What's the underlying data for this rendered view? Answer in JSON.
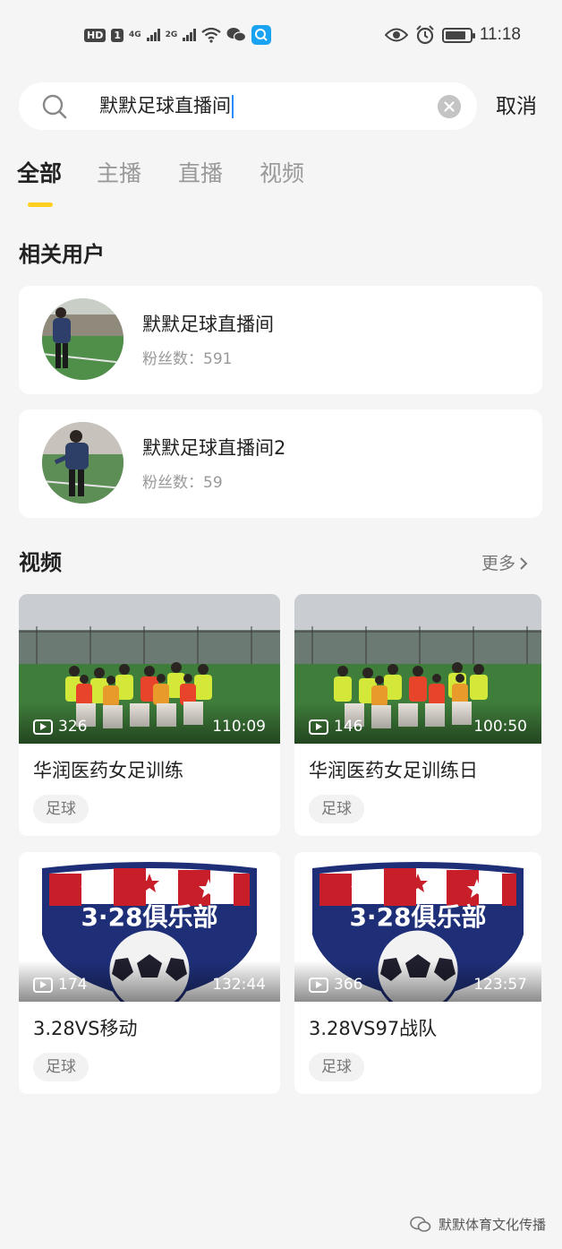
{
  "status_bar": {
    "hd": "HD",
    "sim": "1",
    "net1": "4G",
    "net2": "2G",
    "time": "11:18",
    "battery_level": 0.85
  },
  "search": {
    "query": "默默足球直播间",
    "cancel_label": "取消"
  },
  "tabs": [
    {
      "label": "全部",
      "active": true
    },
    {
      "label": "主播",
      "active": false
    },
    {
      "label": "直播",
      "active": false
    },
    {
      "label": "视频",
      "active": false
    }
  ],
  "users_section": {
    "title": "相关用户",
    "users": [
      {
        "name": "默默足球直播间",
        "fans": "粉丝数：591"
      },
      {
        "name": "默默足球直播间2",
        "fans": "粉丝数：59"
      }
    ]
  },
  "videos_section": {
    "title": "视频",
    "more_label": "更多",
    "videos": [
      {
        "title": "华润医药女足训练",
        "plays": "326",
        "duration": "110:09",
        "tag": "足球",
        "thumb": "team"
      },
      {
        "title": "华润医药女足训练日",
        "plays": "146",
        "duration": "100:50",
        "tag": "足球",
        "thumb": "team"
      },
      {
        "title": "3.28VS移动",
        "plays": "174",
        "duration": "132:44",
        "tag": "足球",
        "thumb": "badge",
        "badge_text": "3·28俱乐部"
      },
      {
        "title": "3.28VS97战队",
        "plays": "366",
        "duration": "123:57",
        "tag": "足球",
        "thumb": "badge",
        "badge_text": "3·28俱乐部"
      }
    ]
  },
  "watermark": {
    "text": "默默体育文化传播"
  },
  "colors": {
    "accent": "#ffcf1f",
    "caret": "#2a8cff",
    "badge_red": "#c81e2a",
    "badge_navy": "#1e2f78"
  }
}
